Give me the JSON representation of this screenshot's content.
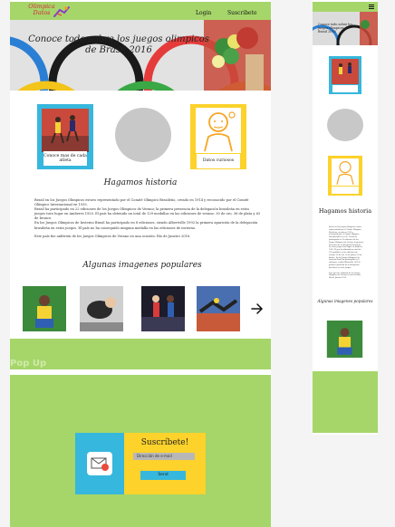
{
  "desktop": {
    "logo": {
      "line1": "Olimpica",
      "line2": "Datos"
    },
    "nav": {
      "login": "Login",
      "subscribe": "Suscribete"
    },
    "hero": {
      "title": "Conoce todo sobre los juegos olimpicos de Brasil 2016"
    },
    "cards": [
      {
        "caption": "Conoce mas de cada atleta"
      },
      {
        "caption": ""
      },
      {
        "caption": "Datos curiosos"
      }
    ],
    "history": {
      "title": "Hagamos historia",
      "p1": "Brasil en los Juegos Olimpicos estuvo representado por el Comité Olímpico Brasileño, creado en 1914 y reconocido por el Comité Olímpico Internacional en 1935.",
      "p2": "Brasil ha participado en 22 ediciones de los Juegos Olímpicos de Verano; la primera presencia de la delegación brasileña en estos juegos tuvo lugar en Amberes 1920. El país ha obtenido un total de 129 medallas en las ediciones de verano: 30 de oro, 36 de plata y 63 de bronce.",
      "p3": "En los Juegos Olímpicos de Invierno Brasil ha participado en 8 ediciones, siendo Albertville 1992 la primera aparición de la delegación brasileña en estos juegos. El país no ha conseguido ninguna medalla en las ediciones de invierno.",
      "p4": "Este país fue anfitrión de los Juegos Olímpicos de Verano en una ocasión: Río de Janeiro 2016."
    },
    "gallery": {
      "title": "Algunas imagenes populares"
    },
    "popup": {
      "label": "Pop Up",
      "title": "Suscríbete!",
      "email_placeholder": "Dirección de e-mail",
      "send": "Send"
    }
  },
  "mobile": {
    "hero_title": "Conoce todo sobre los juegos olimpicos de Brasil 2016",
    "history_title": "Hagamos historia",
    "history_text": "Brasil en los Juegos Olímpicos estuvo representado por el Comité Olímpico Brasileño, creado en 1914 y reconocido por el Comité Olímpico Internacional en 1935. Brasil ha participado en 22 ediciones de los Juegos Olímpicos de Verano; la primera presencia de la delegación brasileña en estos juegos tuvo lugar en Amberes 1920. El país ha obtenido un total de 129 medallas en las ediciones de verano: 30 de oro, 36 de plata y 63 de bronce. En los Juegos Olímpicos de Invierno Brasil ha participado en 8 ediciones, siendo Albertville 1992 la primera aparición de la delegación brasileña en estos juegos.",
    "history_text2": "Este país fue anfitrión de los Juegos Olímpicos de Verano en una ocasión: Río de Janeiro 2016.",
    "gallery_title": "Algunas imagenes populares"
  },
  "colors": {
    "green": "#a6d66a",
    "yellow": "#fcd22b",
    "blue": "#36b7dd",
    "orange": "#f5a623"
  },
  "icons": {
    "menu": "hamburger-icon",
    "next": "arrow-right-icon"
  }
}
